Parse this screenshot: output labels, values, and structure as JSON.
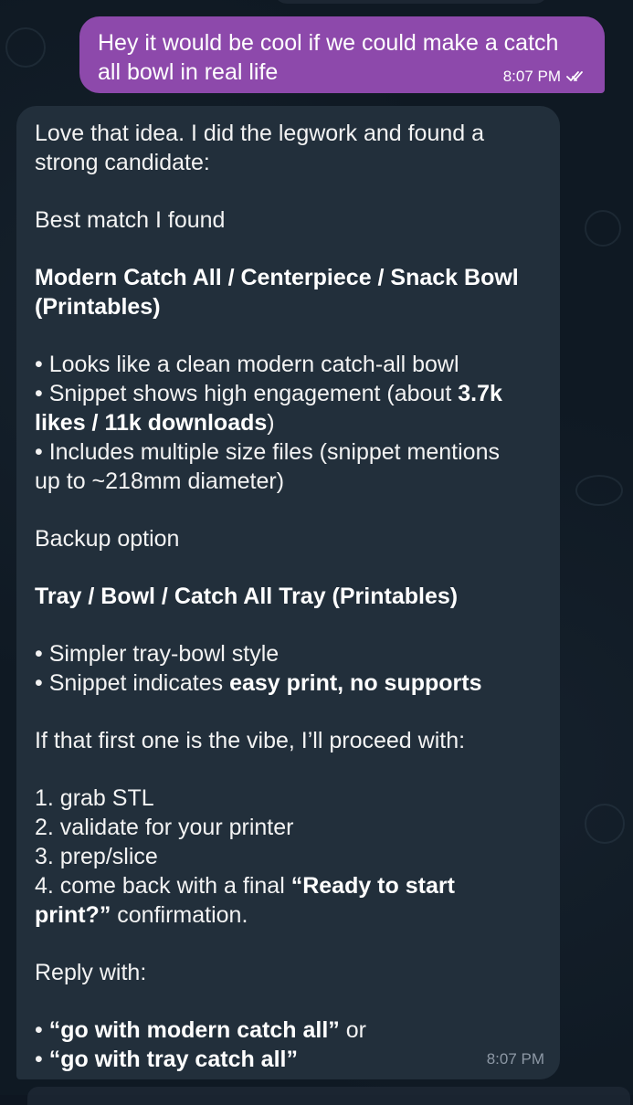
{
  "outgoing_message": {
    "lines": [
      "Hey it would be cool if we could make a catch",
      "all bowl in real life"
    ],
    "time": "8:07 PM",
    "status_icon": "double-check-icon"
  },
  "incoming_message": {
    "intro": [
      "Love that idea. I did the legwork and found a",
      "strong candidate:"
    ],
    "best_match_heading": "Best match I found",
    "best_match_title": [
      "Modern Catch All / Centerpiece / Snack Bowl",
      "(Printables)"
    ],
    "best_bullet_1": "• Looks like a clean modern catch-all bowl",
    "best_bullet_2_a": "• Snippet shows high engagement (about ",
    "best_bullet_2_b": "3.7k",
    "best_bullet_2_c": "likes / 11k downloads",
    "best_bullet_2_d": ")",
    "best_bullet_3": [
      "• Includes multiple size files (snippet mentions",
      "up to ~218mm diameter)"
    ],
    "backup_heading": "Backup option",
    "backup_title": "Tray / Bowl / Catch All Tray (Printables)",
    "backup_bullet_1": "• Simpler tray-bowl style",
    "backup_bullet_2_a": "• Snippet indicates ",
    "backup_bullet_2_b": "easy print, no supports",
    "proceed_text": "If that first one is the vibe, I’ll proceed with:",
    "steps": [
      "1. grab STL",
      "2. validate for your printer",
      "3. prep/slice"
    ],
    "step_4_a": "4. come back with a final ",
    "step_4_b": "“Ready to start",
    "step_4_c": "print?”",
    "step_4_d": " confirmation.",
    "reply_with": "Reply with:",
    "reply_1_a": "• ",
    "reply_1_b": "“go with modern catch all”",
    "reply_1_c": " or",
    "reply_2_a": "• ",
    "reply_2_b": "“go with tray catch all”",
    "time": "8:07 PM"
  }
}
